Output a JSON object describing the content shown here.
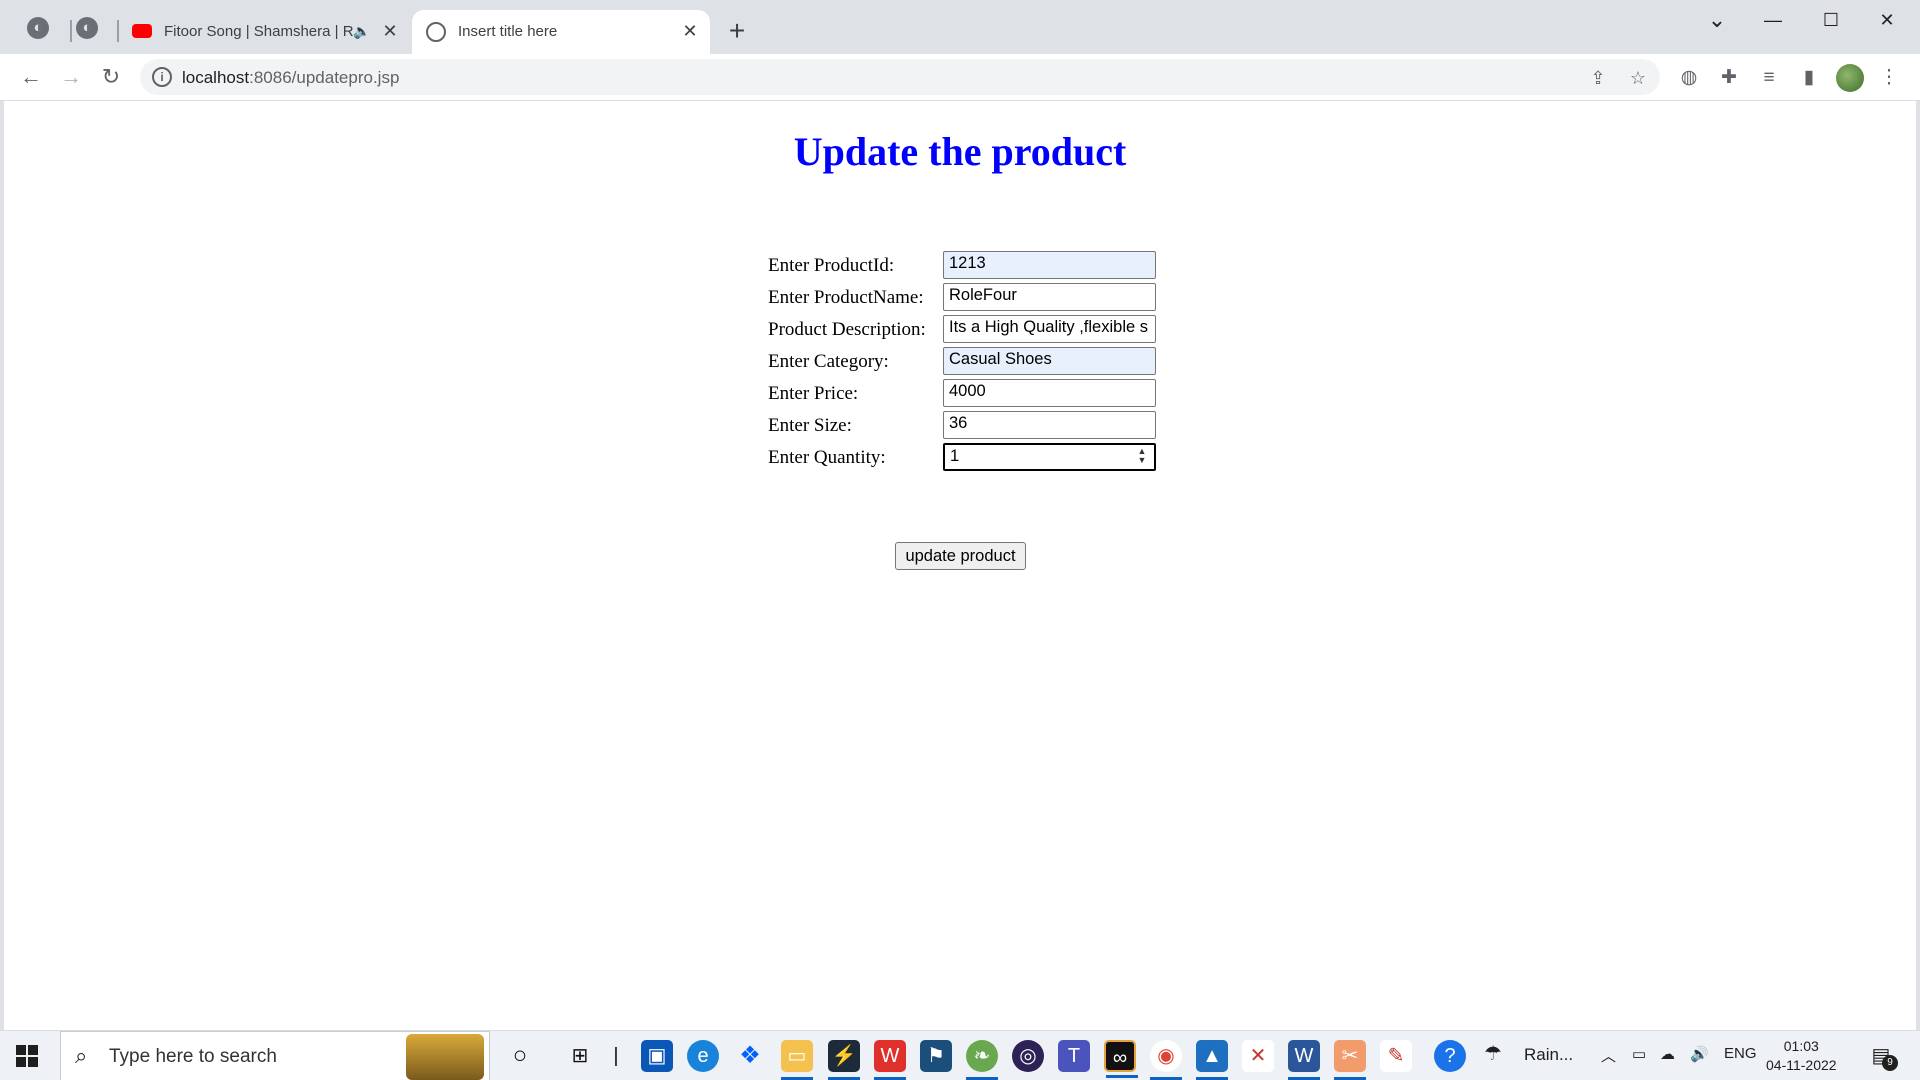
{
  "browser": {
    "tabs": [
      {
        "label": "Fitoor Song | Shamshera | Ra",
        "icon": "youtube-icon",
        "audio_icon": "🔈",
        "close": "✕"
      },
      {
        "label": "Insert title here",
        "icon": "globe-icon",
        "close": "✕"
      }
    ],
    "new_tab": "+",
    "window_controls": {
      "chevron": "⌄",
      "minimize": "—",
      "maximize": "☐",
      "close": "✕"
    },
    "url_host": "localhost",
    "url_rest": ":8086/updatepro.jsp"
  },
  "page": {
    "title": "Update the product",
    "fields": [
      {
        "label": "Enter ProductId:",
        "value": "1213"
      },
      {
        "label": "Enter ProductName:",
        "value": "RoleFour"
      },
      {
        "label": "Product Description:",
        "value": "Its a High Quality ,flexible s"
      },
      {
        "label": "Enter Category:",
        "value": "Casual Shoes"
      },
      {
        "label": "Enter Price:",
        "value": "4000"
      },
      {
        "label": "Enter Size:",
        "value": "36"
      },
      {
        "label": "Enter Quantity:",
        "value": "1"
      }
    ],
    "submit_label": "update product"
  },
  "taskbar": {
    "search_placeholder": "Type here to search",
    "weather": "Rain...",
    "language": "ENG",
    "time": "01:03",
    "date": "04-11-2022",
    "notification_count": "9"
  },
  "colors": {
    "title": "#0000ff",
    "autofill": "#e8f0fe",
    "tabstrip": "#dee1e6"
  }
}
